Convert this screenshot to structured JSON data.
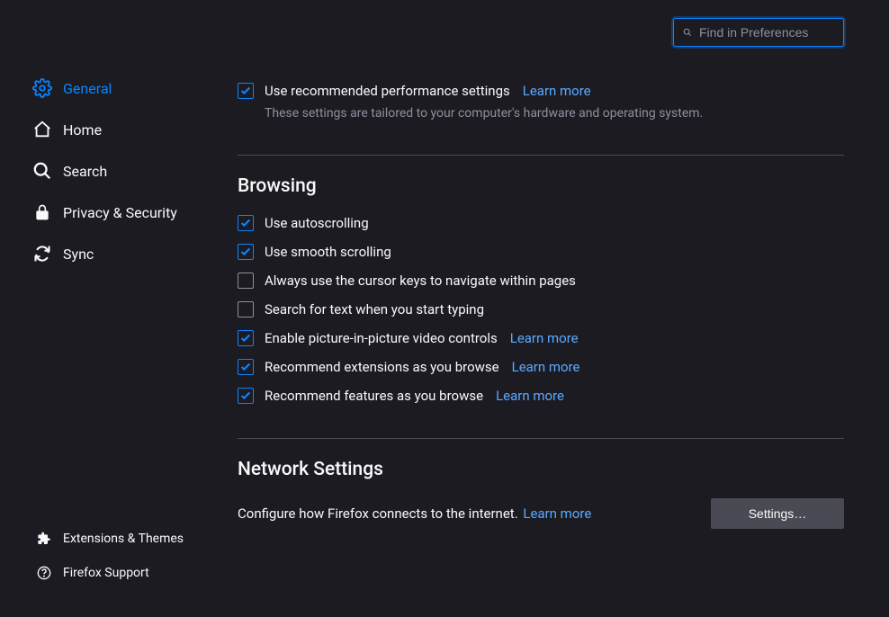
{
  "search": {
    "placeholder": "Find in Preferences"
  },
  "sidebar": {
    "items": [
      {
        "label": "General"
      },
      {
        "label": "Home"
      },
      {
        "label": "Search"
      },
      {
        "label": "Privacy & Security"
      },
      {
        "label": "Sync"
      }
    ],
    "footer": [
      {
        "label": "Extensions & Themes"
      },
      {
        "label": "Firefox Support"
      }
    ]
  },
  "perf": {
    "option": "Use recommended performance settings",
    "learn": "Learn more",
    "subtext": "These settings are tailored to your computer's hardware and operating system."
  },
  "browsing": {
    "heading": "Browsing",
    "options": [
      {
        "label": "Use autoscrolling"
      },
      {
        "label": "Use smooth scrolling"
      },
      {
        "label": "Always use the cursor keys to navigate within pages"
      },
      {
        "label": "Search for text when you start typing"
      },
      {
        "label": "Enable picture-in-picture video controls",
        "learn": "Learn more"
      },
      {
        "label": "Recommend extensions as you browse",
        "learn": "Learn more"
      },
      {
        "label": "Recommend features as you browse",
        "learn": "Learn more"
      }
    ]
  },
  "network": {
    "heading": "Network Settings",
    "text": "Configure how Firefox connects to the internet.",
    "learn": "Learn more",
    "button": "Settings…"
  }
}
